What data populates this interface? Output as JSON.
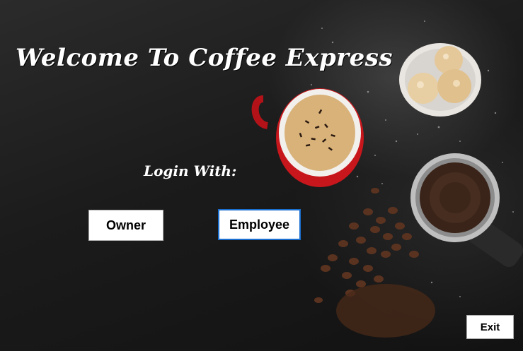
{
  "window": {
    "title": "Welcome To Coffee Express"
  },
  "login": {
    "label": "Login With:",
    "owner_label": "Owner",
    "employee_label": "Employee"
  },
  "footer": {
    "exit_label": "Exit"
  },
  "colors": {
    "background": "#1b1b1b",
    "text": "#ffffff",
    "focus_border": "#1a6fd1",
    "cup_red": "#c8171c",
    "coffee_foam": "#d9b27a"
  },
  "icons": [
    "coffee-cup-illustration",
    "cookies-bowl-illustration",
    "portafilter-illustration",
    "coffee-beans-illustration"
  ]
}
